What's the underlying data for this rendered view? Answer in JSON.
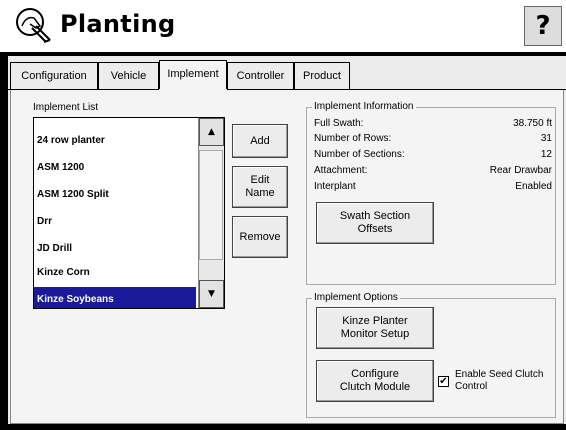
{
  "header": {
    "title": "Planting",
    "help_label": "?",
    "icon": "planter-hand-icon"
  },
  "tabs": [
    {
      "label": "Configuration",
      "active": false
    },
    {
      "label": "Vehicle",
      "active": false
    },
    {
      "label": "Implement",
      "active": true
    },
    {
      "label": "Controller",
      "active": false
    },
    {
      "label": "Product",
      "active": false
    }
  ],
  "implement_list": {
    "label": "Implement List",
    "items": [
      "24 row planter",
      "ASM 1200",
      "ASM 1200 Split",
      "Drr",
      "JD Drill",
      "Kinze Corn",
      "Kinze Soybeans"
    ],
    "selected": "Kinze Soybeans"
  },
  "buttons": {
    "add": "Add",
    "edit_name": "Edit Name",
    "remove": "Remove"
  },
  "implement_information": {
    "legend": "Implement Information",
    "rows": [
      {
        "key": "Full Swath:",
        "value": "38.750 ft"
      },
      {
        "key": "Number of Rows:",
        "value": "31"
      },
      {
        "key": "Number of Sections:",
        "value": "12"
      },
      {
        "key": "Attachment:",
        "value": "Rear Drawbar"
      },
      {
        "key": "Interplant",
        "value": "Enabled"
      }
    ],
    "swath_button": "Swath Section Offsets"
  },
  "implement_options": {
    "legend": "Implement Options",
    "monitor_button": "Kinze Planter Monitor Setup",
    "clutch_button": "Configure Clutch Module",
    "seed_checkbox_label": "Enable Seed Clutch Control",
    "seed_checkbox_checked": true
  },
  "colors": {
    "selection": "#1a1a9a",
    "background": "#000000",
    "panel": "#f4f4f4"
  }
}
